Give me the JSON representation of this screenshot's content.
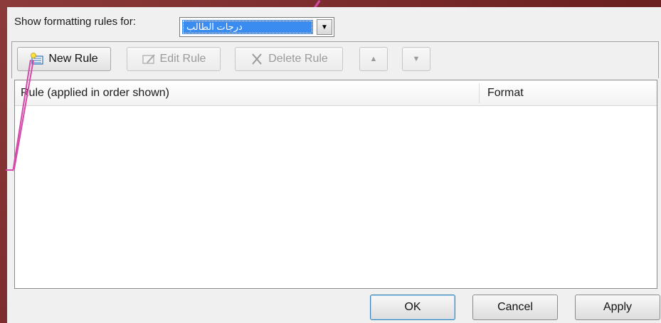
{
  "dialog": {
    "show_label": "Show formatting rules for:",
    "show_value": "درجات الطالب",
    "colors": {
      "accent": "#3b8cf0",
      "annotation": "#d44aa8",
      "backdrop": "#7a2a2a"
    }
  },
  "toolbar": {
    "new_rule": "New Rule",
    "edit_rule": "Edit Rule",
    "delete_rule": "Delete Rule",
    "move_up_icon": "triangle-up-icon",
    "move_down_icon": "triangle-down-icon"
  },
  "rules_list": {
    "columns": [
      "Rule (applied in order shown)",
      "Format"
    ],
    "rows": []
  },
  "footer": {
    "ok": "OK",
    "cancel": "Cancel",
    "apply": "Apply"
  }
}
